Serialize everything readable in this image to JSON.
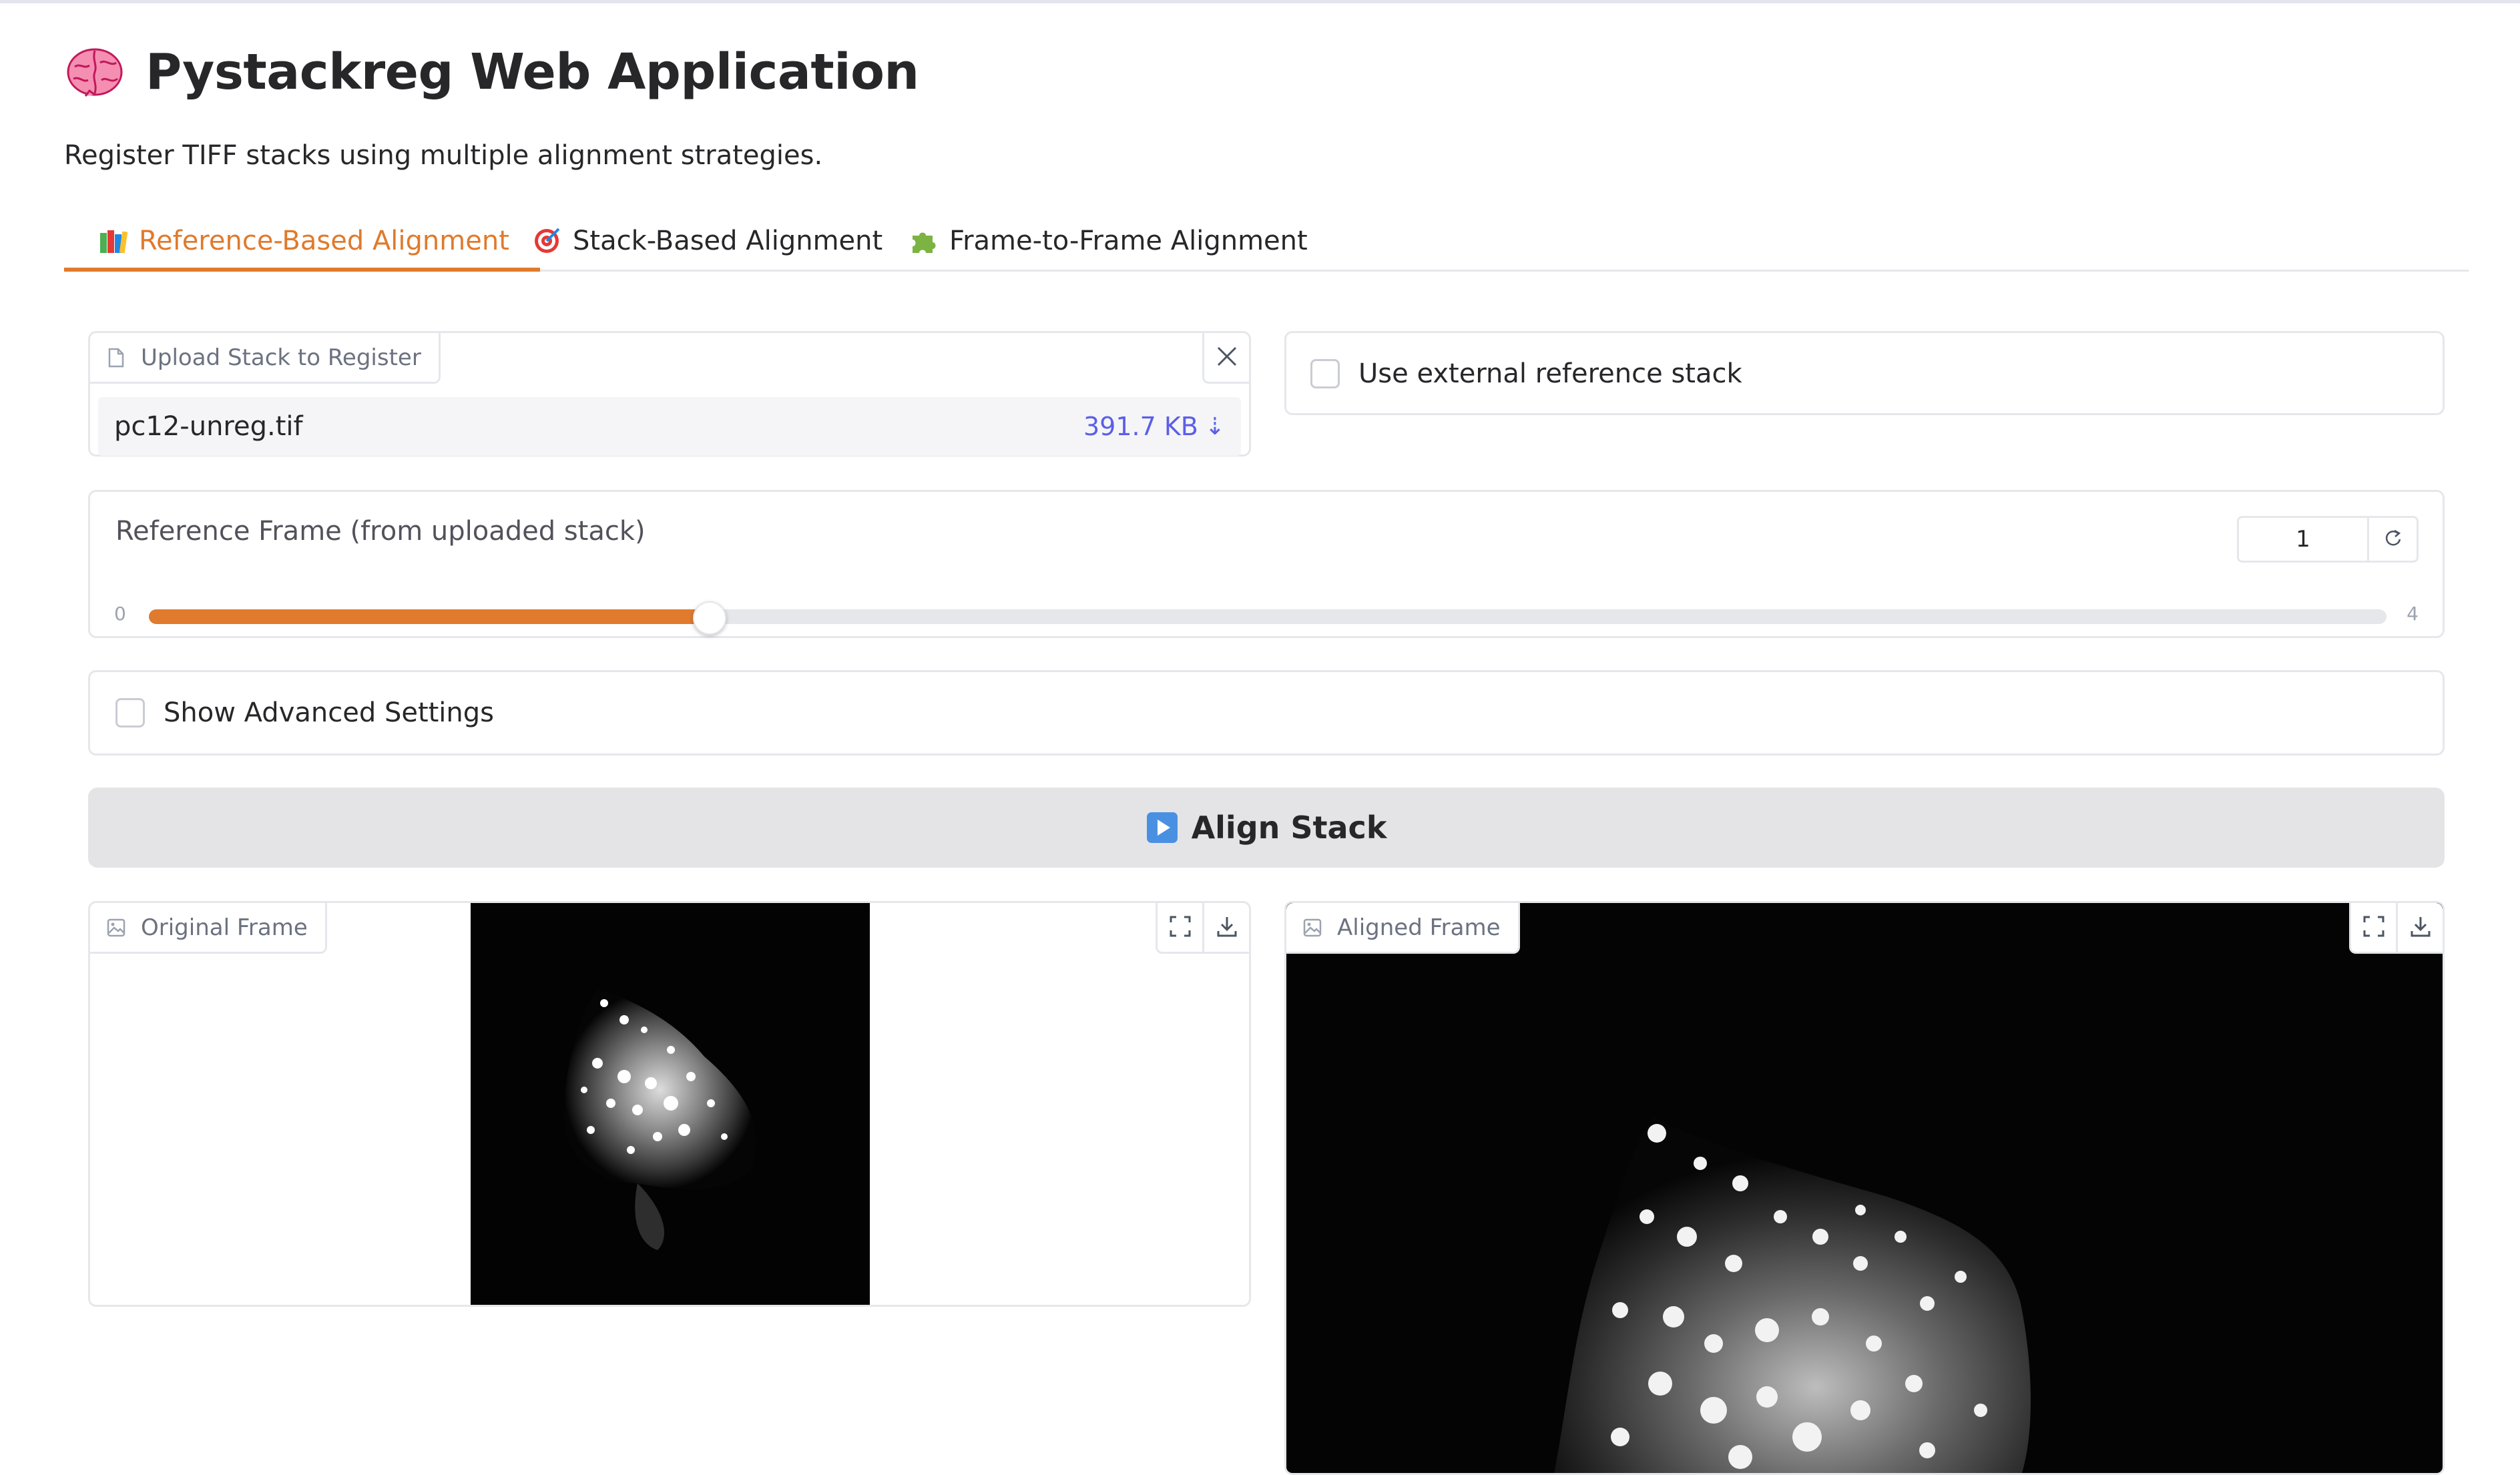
{
  "app": {
    "title": "Pystackreg Web Application",
    "subtitle": "Register TIFF stacks using multiple alignment strategies."
  },
  "tabs": [
    {
      "label": "Reference-Based Alignment",
      "active": true,
      "icon": "books-icon"
    },
    {
      "label": "Stack-Based Alignment",
      "active": false,
      "icon": "target-icon"
    },
    {
      "label": "Frame-to-Frame Alignment",
      "active": false,
      "icon": "puzzle-icon"
    }
  ],
  "upload": {
    "label": "Upload Stack to Register",
    "file_name": "pc12-unreg.tif",
    "file_size": "391.7 KB",
    "download_glyph": "⇣"
  },
  "external_ref": {
    "label": "Use external reference stack",
    "checked": false
  },
  "reference_frame": {
    "label": "Reference Frame (from uploaded stack)",
    "value": "1",
    "min": "0",
    "max": "4",
    "fraction": 0.25
  },
  "advanced": {
    "label": "Show Advanced Settings",
    "checked": false
  },
  "align_button": {
    "label": "Align Stack"
  },
  "original_frame": {
    "label": "Original Frame"
  },
  "aligned_frame": {
    "label": "Aligned Frame"
  },
  "colors": {
    "accent": "#e07a2c",
    "link": "#5b5fe6",
    "border": "#e5e7eb",
    "button_bg": "#e4e4e7"
  }
}
